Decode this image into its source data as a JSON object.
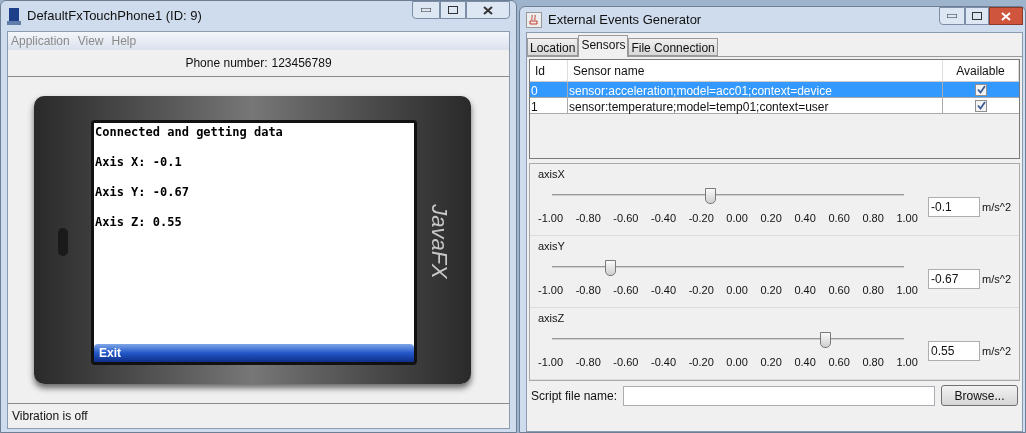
{
  "phone_window": {
    "title": "DefaultFxTouchPhone1 (ID: 9)",
    "menu": [
      "Application",
      "View",
      "Help"
    ],
    "phone_number_label": "Phone number:",
    "phone_number": "123456789",
    "phone": {
      "logo": "JavaFX",
      "screen_lines": [
        "Connected and getting data",
        "Axis X: -0.1",
        "Axis Y: -0.67",
        "Axis Z: 0.55"
      ],
      "softkey": "Exit"
    },
    "status_bar": "Vibration is off"
  },
  "events_window": {
    "title": "External Events Generator",
    "tabs": [
      {
        "label": "Location",
        "selected": false
      },
      {
        "label": "Sensors",
        "selected": true
      },
      {
        "label": "File Connection",
        "selected": false
      }
    ],
    "table": {
      "columns": [
        "Id",
        "Sensor name",
        "Available"
      ],
      "rows": [
        {
          "id": "0",
          "name": "sensor:acceleration;model=acc01;context=device",
          "available": true,
          "selected": true
        },
        {
          "id": "1",
          "name": "sensor:temperature;model=temp01;context=user",
          "available": true,
          "selected": false
        }
      ]
    },
    "sliders": [
      {
        "label": "axisX",
        "level": 0.45,
        "value": "-0.1",
        "unit": "m/s^2",
        "ticks": [
          "-1.00",
          "-0.80",
          "-0.60",
          "-0.40",
          "-0.20",
          "0.00",
          "0.20",
          "0.40",
          "0.60",
          "0.80",
          "1.00"
        ]
      },
      {
        "label": "axisY",
        "level": 0.165,
        "value": "-0.67",
        "unit": "m/s^2",
        "ticks": [
          "-1.00",
          "-0.80",
          "-0.60",
          "-0.40",
          "-0.20",
          "0.00",
          "0.20",
          "0.40",
          "0.60",
          "0.80",
          "1.00"
        ]
      },
      {
        "label": "axisZ",
        "level": 0.775,
        "value": "0.55",
        "unit": "m/s^2",
        "ticks": [
          "-1.00",
          "-0.80",
          "-0.60",
          "-0.40",
          "-0.20",
          "0.00",
          "0.20",
          "0.40",
          "0.60",
          "0.80",
          "1.00"
        ]
      }
    ],
    "script_label": "Script file name:",
    "browse_button": "Browse..."
  }
}
